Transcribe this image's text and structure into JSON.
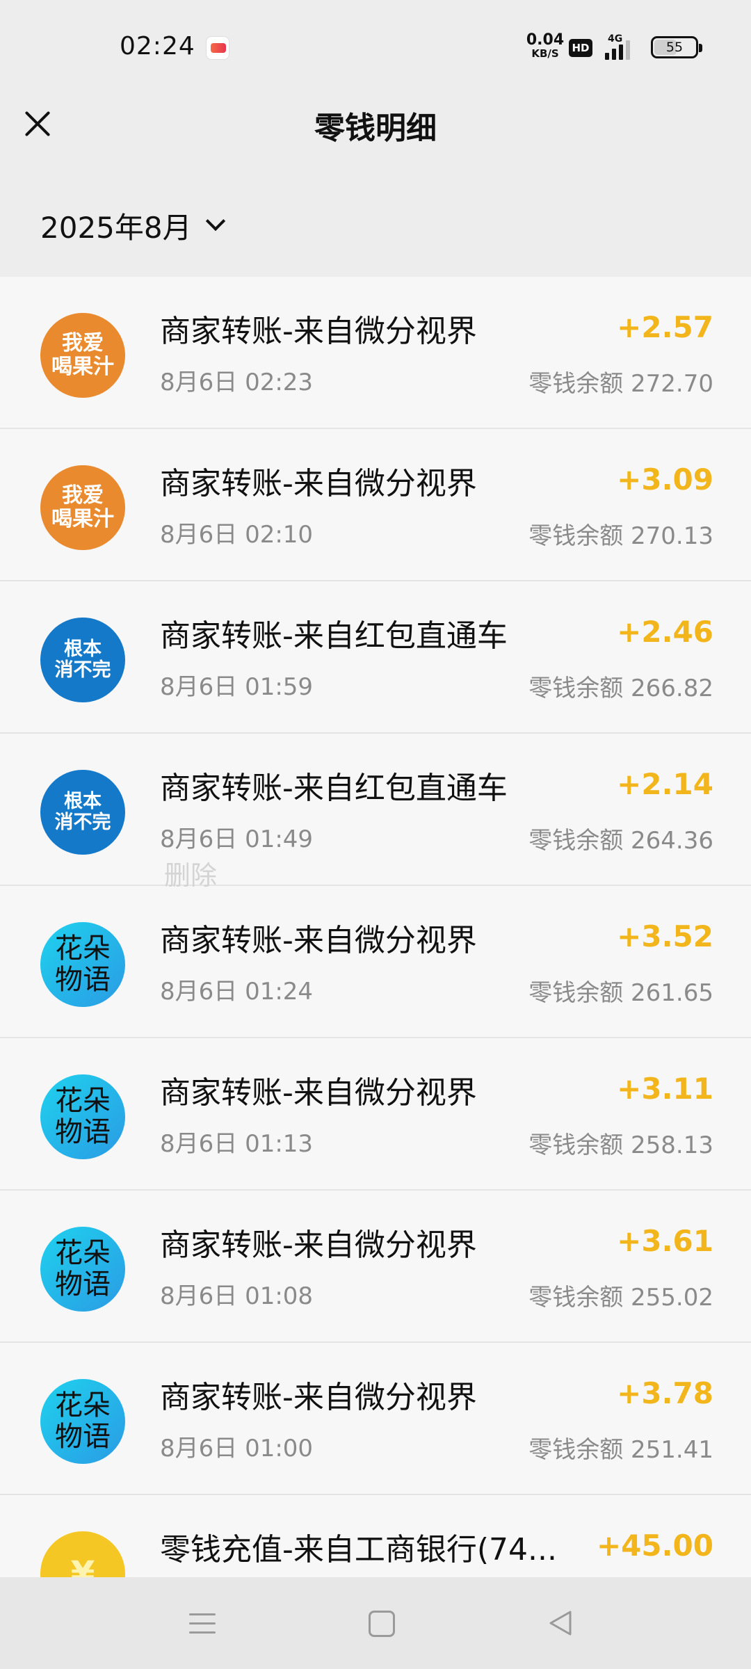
{
  "status_bar": {
    "time": "02:24",
    "net_speed_value": "0.04",
    "net_speed_unit": "KB/S",
    "hd_badge": "HD",
    "network_type": "4G",
    "battery_level": "55"
  },
  "header": {
    "title": "零钱明细"
  },
  "filter": {
    "month": "2025年8月"
  },
  "transactions": [
    {
      "avatar_text": "我爱\n喝果汁",
      "avatar_style": "orange",
      "title": "商家转账-来自微分视界",
      "time": "8月6日 02:23",
      "amount": "+2.57",
      "balance": "零钱余额 272.70"
    },
    {
      "avatar_text": "我爱\n喝果汁",
      "avatar_style": "orange",
      "title": "商家转账-来自微分视界",
      "time": "8月6日 02:10",
      "amount": "+3.09",
      "balance": "零钱余额 270.13"
    },
    {
      "avatar_text": "根本\n消不完",
      "avatar_style": "blue",
      "title": "商家转账-来自红包直通车",
      "time": "8月6日 01:59",
      "amount": "+2.46",
      "balance": "零钱余额 266.82"
    },
    {
      "avatar_text": "根本\n消不完",
      "avatar_style": "blue",
      "title": "商家转账-来自红包直通车",
      "time": "8月6日 01:49",
      "amount": "+2.14",
      "balance": "零钱余额 264.36"
    },
    {
      "avatar_text": "花朵\n物语",
      "avatar_style": "cyan",
      "title": "商家转账-来自微分视界",
      "time": "8月6日 01:24",
      "amount": "+3.52",
      "balance": "零钱余额 261.65"
    },
    {
      "avatar_text": "花朵\n物语",
      "avatar_style": "cyan",
      "title": "商家转账-来自微分视界",
      "time": "8月6日 01:13",
      "amount": "+3.11",
      "balance": "零钱余额 258.13"
    },
    {
      "avatar_text": "花朵\n物语",
      "avatar_style": "cyan",
      "title": "商家转账-来自微分视界",
      "time": "8月6日 01:08",
      "amount": "+3.61",
      "balance": "零钱余额 255.02"
    },
    {
      "avatar_text": "花朵\n物语",
      "avatar_style": "cyan",
      "title": "商家转账-来自微分视界",
      "time": "8月6日 01:00",
      "amount": "+3.78",
      "balance": "零钱余额 251.41"
    },
    {
      "avatar_text": "¥",
      "avatar_style": "yellow",
      "title": "零钱充值-来自工商银行(74...",
      "time": "",
      "amount": "+45.00",
      "balance": ""
    }
  ],
  "overlay": {
    "delete_label": "删除"
  },
  "colors": {
    "amount": "#f2b61c",
    "page_bg": "#ededed",
    "list_bg": "#f7f7f7"
  }
}
